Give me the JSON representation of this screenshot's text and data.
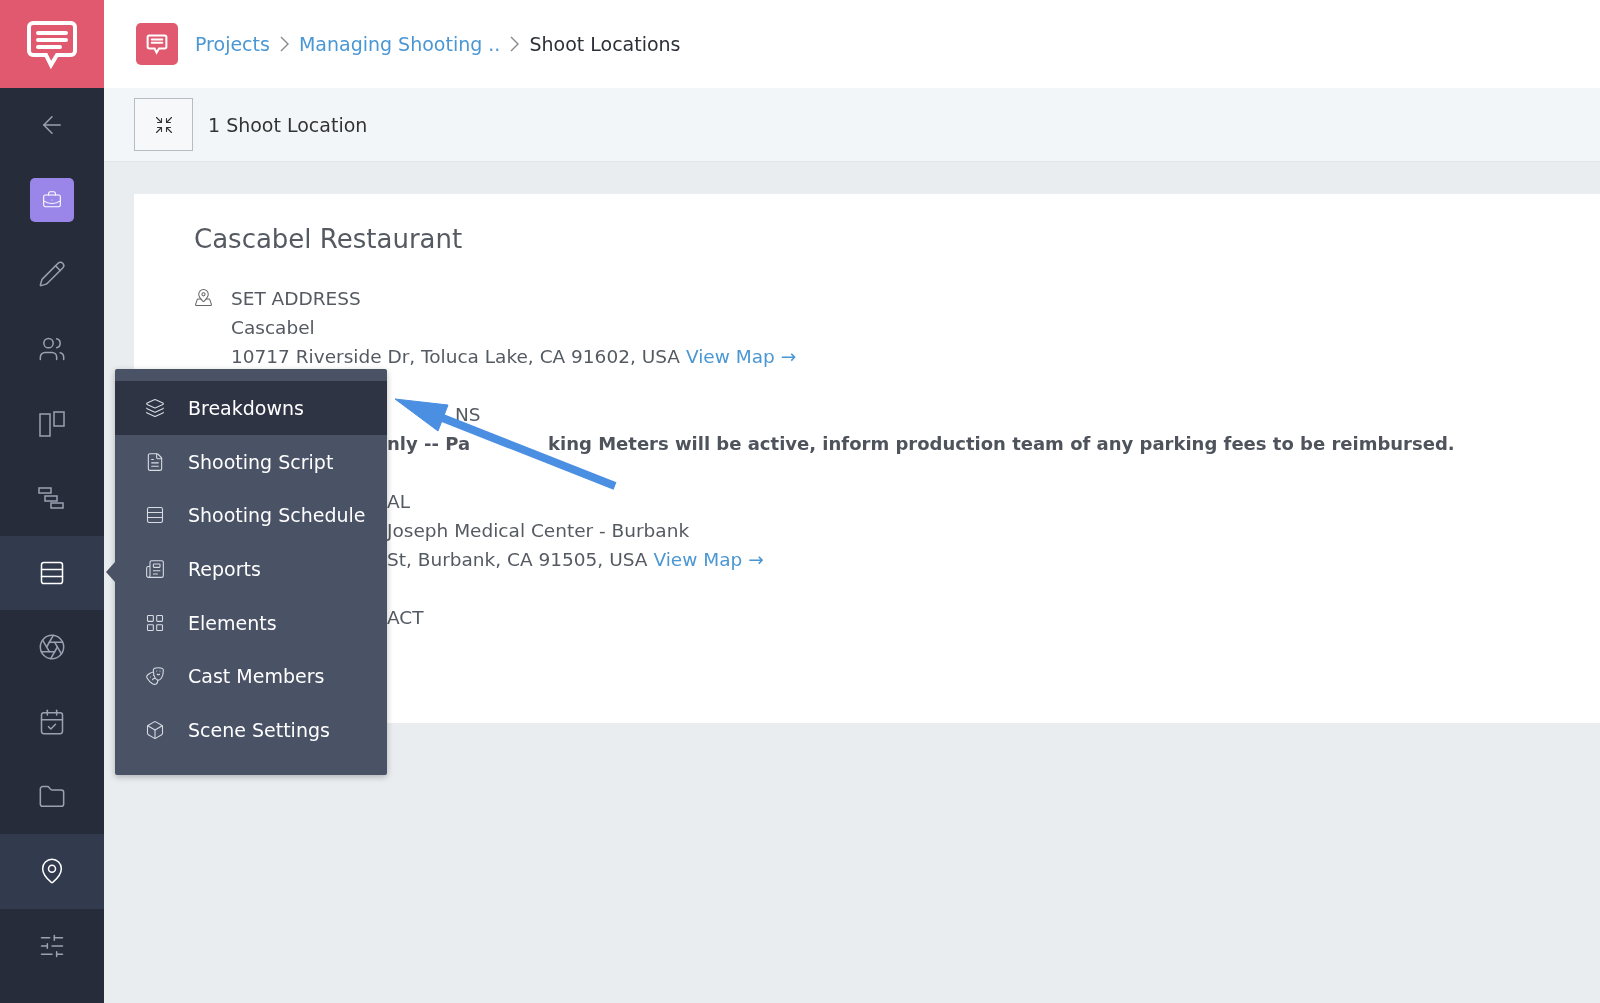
{
  "sidebar": {
    "items": [
      {
        "selected": false
      },
      {
        "selected": false,
        "kind": "badge"
      },
      {
        "selected": false
      },
      {
        "selected": false
      },
      {
        "selected": false
      },
      {
        "selected": false
      },
      {
        "selected": true
      },
      {
        "selected": false
      },
      {
        "selected": false
      },
      {
        "selected": false
      },
      {
        "selected": true
      },
      {
        "selected": false
      }
    ]
  },
  "breadcrumbs": [
    {
      "label": "Projects",
      "kind": "link"
    },
    {
      "label": "Managing Shooting ..",
      "kind": "link"
    },
    {
      "label": "Shoot Locations",
      "kind": "current"
    }
  ],
  "toolbar": {
    "count": "1 Shoot Location"
  },
  "location": {
    "title": "Cascabel Restaurant",
    "sections": [
      {
        "label": "SET ADDRESS",
        "clipped": false,
        "lines": [
          "Cascabel"
        ],
        "address": "10717 Riverside Dr, Toluca Lake, CA 91602, USA",
        "link": "View Map →"
      },
      {
        "label": "NS",
        "clipped": true,
        "note_parts": [
          "nly -- Pa",
          "king Meters will be active, inform production team of any parking fees to be reimbursed."
        ]
      },
      {
        "label": "AL",
        "clipped": true,
        "lines": [
          "Joseph Medical Center - Burbank"
        ],
        "address": "St, Burbank, CA 91505, USA",
        "link": "View Map →"
      },
      {
        "label": "ACT",
        "clipped": true
      }
    ]
  },
  "menu": {
    "items": [
      {
        "label": "Breakdowns",
        "selected": true
      },
      {
        "label": "Shooting Script",
        "selected": false
      },
      {
        "label": "Shooting Schedule",
        "selected": false
      },
      {
        "label": "Reports",
        "selected": false
      },
      {
        "label": "Elements",
        "selected": false
      },
      {
        "label": "Cast Members",
        "selected": false
      },
      {
        "label": "Scene Settings",
        "selected": false
      }
    ]
  }
}
